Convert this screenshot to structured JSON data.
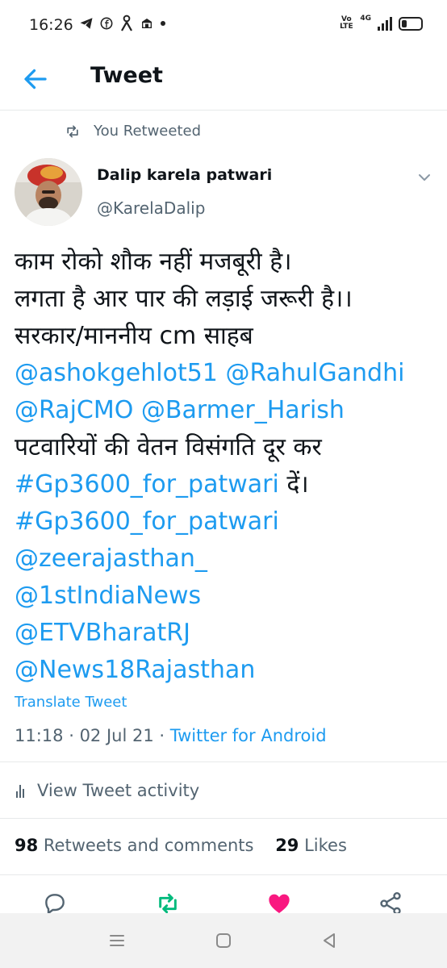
{
  "status_bar": {
    "time": "16:26",
    "left_icons": [
      "telegram-icon",
      "facebook-icon",
      "person-icon",
      "bank-icon",
      "dot-icon"
    ],
    "volte": "Vo LTE",
    "network": "4G"
  },
  "header": {
    "title": "Tweet"
  },
  "retweet_label": "You Retweeted",
  "author": {
    "name": "Dalip karela patwari",
    "handle": "@KarelaDalip"
  },
  "tweet": {
    "line1": "काम रोको शौक नहीं मजबूरी है।",
    "line2": "लगता है आर पार की लड़ाई जरूरी है।।",
    "line3": "सरकार/माननीय cm साहब",
    "mention_ashok": "@ashokgehlot51",
    "mention_rahul": "@RahulGandhi",
    "mention_rajcmo": "@RajCMO",
    "mention_barmer": "@Barmer_Harish",
    "line6": "पटवारियों की वेतन विसंगति दूर कर",
    "hashtag1": "#Gp3600_for_patwari",
    "line7_suffix": " दें।",
    "hashtag2": "#Gp3600_for_patwari",
    "mention_zee": "@zeerajasthan_",
    "mention_1st": "@1stIndiaNews",
    "mention_etv": "@ETVBharatRJ",
    "mention_news18": "@News18Rajasthan"
  },
  "translate_label": "Translate Tweet",
  "meta": {
    "time": "11:18",
    "sep1": " · ",
    "date": "02 Jul 21",
    "sep2": " · ",
    "client": "Twitter for Android"
  },
  "activity_label": "View Tweet activity",
  "stats": {
    "retweets_count": "98",
    "retweets_label": " Retweets and comments",
    "likes_count": "29",
    "likes_label": " Likes"
  },
  "colors": {
    "link": "#1d9bf0",
    "retweet_active": "#00ba7c",
    "like_active": "#f91880",
    "secondary_text": "#536471"
  }
}
